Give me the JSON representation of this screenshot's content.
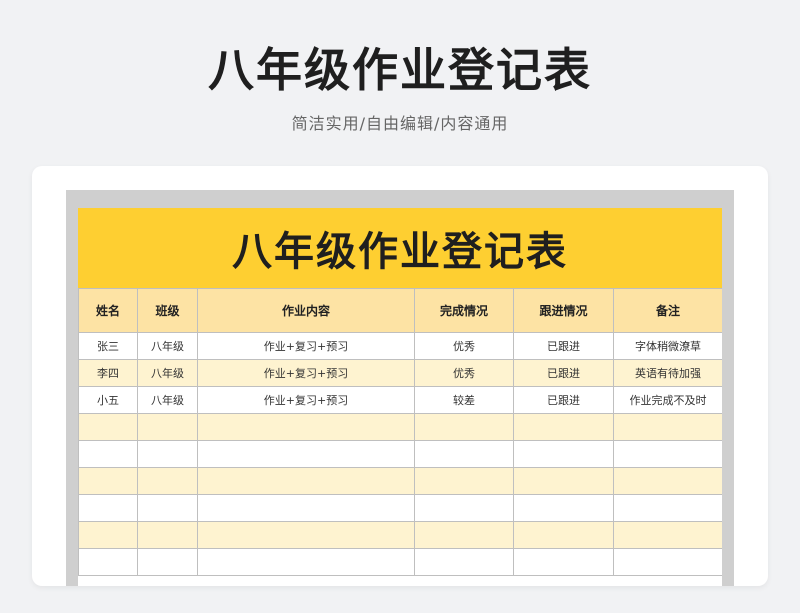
{
  "page": {
    "title": "八年级作业登记表",
    "subtitle": "简洁实用/自由编辑/内容通用"
  },
  "sheet": {
    "banner_title": "八年级作业登记表",
    "columns": [
      "姓名",
      "班级",
      "作业内容",
      "完成情况",
      "跟进情况",
      "备注"
    ],
    "rows": [
      [
        "张三",
        "八年级",
        "作业+复习+预习",
        "优秀",
        "已跟进",
        "字体稍微潦草"
      ],
      [
        "李四",
        "八年级",
        "作业+复习+预习",
        "优秀",
        "已跟进",
        "英语有待加强"
      ],
      [
        "小五",
        "八年级",
        "作业+复习+预习",
        "较差",
        "已跟进",
        "作业完成不及时"
      ],
      [
        "",
        "",
        "",
        "",
        "",
        ""
      ],
      [
        "",
        "",
        "",
        "",
        "",
        ""
      ],
      [
        "",
        "",
        "",
        "",
        "",
        ""
      ],
      [
        "",
        "",
        "",
        "",
        "",
        ""
      ],
      [
        "",
        "",
        "",
        "",
        "",
        ""
      ],
      [
        "",
        "",
        "",
        "",
        "",
        ""
      ]
    ]
  },
  "colors": {
    "banner": "#fecf31",
    "header": "#fde3a4",
    "stripe": "#fef3d0",
    "background": "#f1f2f4"
  }
}
